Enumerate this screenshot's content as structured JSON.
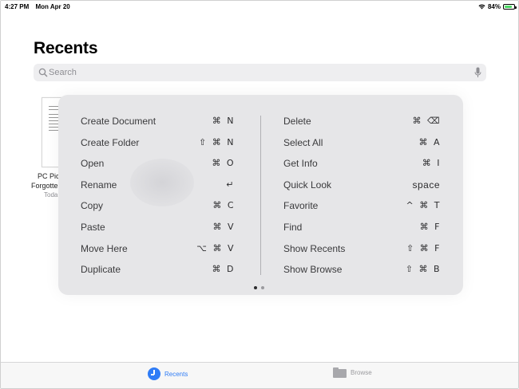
{
  "status_bar": {
    "time": "4:27 PM",
    "date": "Mon Apr 20",
    "battery_percent": "84%",
    "battery_level": 0.84
  },
  "page": {
    "title": "Recents"
  },
  "search": {
    "placeholder": "Search"
  },
  "file": {
    "name_line1": "PC Pic",
    "name_line2": "Forgotte",
    "date": "Toda"
  },
  "shortcuts": {
    "left": [
      {
        "label": "Create Document",
        "keys": [
          "⌘",
          "N"
        ]
      },
      {
        "label": "Create Folder",
        "keys": [
          "⇧",
          "⌘",
          "N"
        ]
      },
      {
        "label": "Open",
        "keys": [
          "⌘",
          "O"
        ]
      },
      {
        "label": "Rename",
        "keys": [
          "↵"
        ]
      },
      {
        "label": "Copy",
        "keys": [
          "⌘",
          "C"
        ]
      },
      {
        "label": "Paste",
        "keys": [
          "⌘",
          "V"
        ]
      },
      {
        "label": "Move Here",
        "keys": [
          "⌥",
          "⌘",
          "V"
        ]
      },
      {
        "label": "Duplicate",
        "keys": [
          "⌘",
          "D"
        ]
      }
    ],
    "right": [
      {
        "label": "Delete",
        "keys": [
          "⌘",
          "⌫"
        ]
      },
      {
        "label": "Select All",
        "keys": [
          "⌘",
          "A"
        ]
      },
      {
        "label": "Get Info",
        "keys": [
          "⌘",
          "I"
        ]
      },
      {
        "label": "Quick Look",
        "keys": [
          "space"
        ]
      },
      {
        "label": "Favorite",
        "keys": [
          "^",
          "⌘",
          "T"
        ]
      },
      {
        "label": "Find",
        "keys": [
          "⌘",
          "F"
        ]
      },
      {
        "label": "Show Recents",
        "keys": [
          "⇧",
          "⌘",
          "F"
        ]
      },
      {
        "label": "Show Browse",
        "keys": [
          "⇧",
          "⌘",
          "B"
        ]
      }
    ],
    "page_count": 2,
    "active_page": 0
  },
  "tab_bar": {
    "recents_label": "Recents",
    "browse_label": "Browse",
    "active_color": "#2f7cf6",
    "inactive_color": "#9a9a9e"
  }
}
